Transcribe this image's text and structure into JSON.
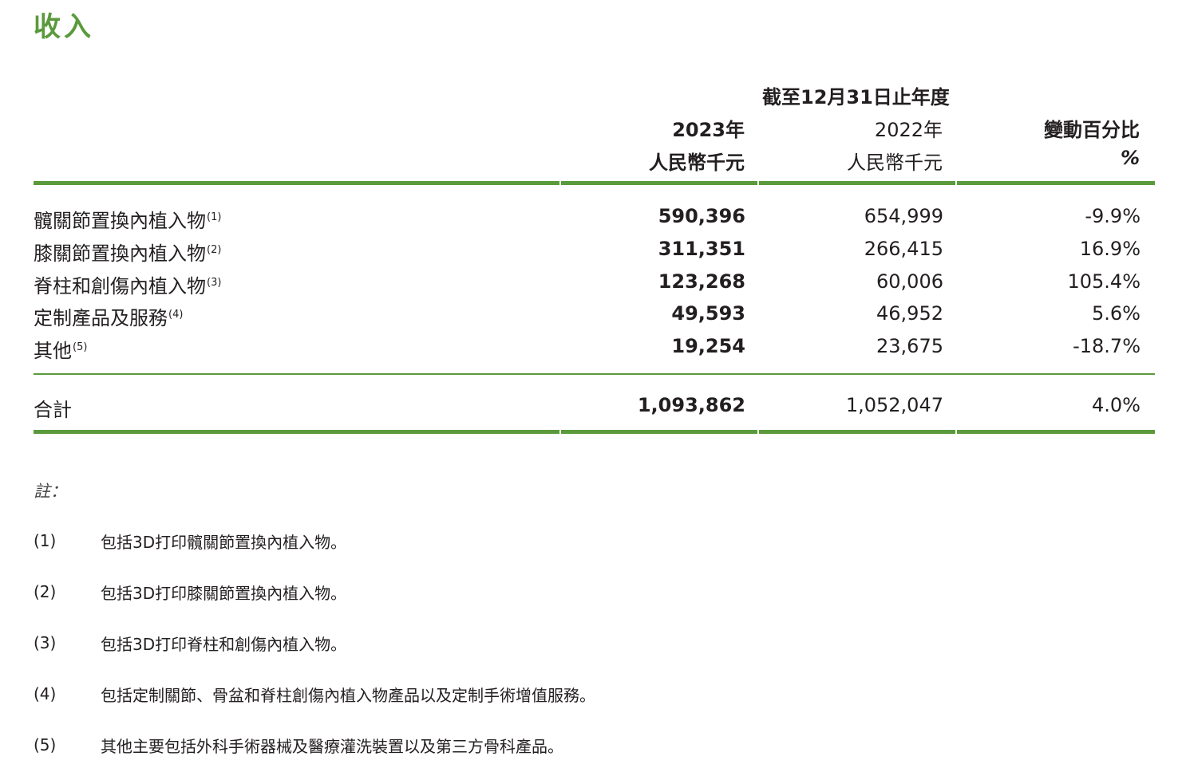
{
  "title": "收入",
  "header": {
    "period": "截至12月31日止年度",
    "col2023_year": "2023年",
    "col2023_unit": "人民幣千元",
    "col2022_year": "2022年",
    "col2022_unit": "人民幣千元",
    "change_label": "變動百分比",
    "change_unit": "%"
  },
  "rows": [
    {
      "label": "髖關節置換內植入物",
      "note": "(1)",
      "v2023": "590,396",
      "v2022": "654,999",
      "change": "-9.9%"
    },
    {
      "label": "膝關節置換內植入物",
      "note": "(2)",
      "v2023": "311,351",
      "v2022": "266,415",
      "change": "16.9%"
    },
    {
      "label": "脊柱和創傷內植入物",
      "note": "(3)",
      "v2023": "123,268",
      "v2022": "60,006",
      "change": "105.4%"
    },
    {
      "label": "定制產品及服務",
      "note": "(4)",
      "v2023": "49,593",
      "v2022": "46,952",
      "change": "5.6%"
    },
    {
      "label": "其他",
      "note": "(5)",
      "v2023": "19,254",
      "v2022": "23,675",
      "change": "-18.7%"
    }
  ],
  "total": {
    "label": "合計",
    "v2023": "1,093,862",
    "v2022": "1,052,047",
    "change": "4.0%"
  },
  "notes_heading": "註：",
  "notes": [
    {
      "num": "(1)",
      "text": "包括3D打印髖關節置換內植入物。"
    },
    {
      "num": "(2)",
      "text": "包括3D打印膝關節置換內植入物。"
    },
    {
      "num": "(3)",
      "text": "包括3D打印脊柱和創傷內植入物。"
    },
    {
      "num": "(4)",
      "text": "包括定制關節、骨盆和脊柱創傷內植入物產品以及定制手術增值服務。"
    },
    {
      "num": "(5)",
      "text": "其他主要包括外科手術器械及醫療灌洗裝置以及第三方骨科產品。"
    }
  ],
  "colors": {
    "accent": "#5a9a3c",
    "text": "#231f20"
  }
}
